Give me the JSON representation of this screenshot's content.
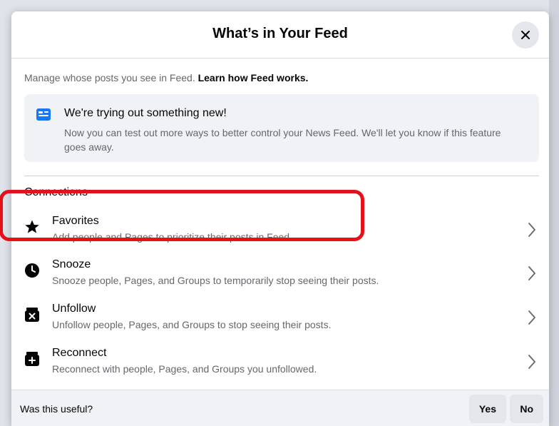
{
  "dialog": {
    "title": "What’s in Your Feed",
    "close_icon": "close-icon"
  },
  "intro": {
    "text": "Manage whose posts you see in Feed. ",
    "link": "Learn how Feed works."
  },
  "notice": {
    "icon": "card-icon",
    "title": "We're trying out something new!",
    "text": "Now you can test out more ways to better control your News Feed. We'll let you know if this feature goes away."
  },
  "connections": {
    "heading": "Connections",
    "items": [
      {
        "icon": "star-icon",
        "title": "Favorites",
        "subtitle": "Add people and Pages to prioritize their posts in Feed."
      },
      {
        "icon": "clock-icon",
        "title": "Snooze",
        "subtitle": "Snooze people, Pages, and Groups to temporarily stop seeing their posts."
      },
      {
        "icon": "unfollow-icon",
        "title": "Unfollow",
        "subtitle": "Unfollow people, Pages, and Groups to stop seeing their posts."
      },
      {
        "icon": "reconnect-icon",
        "title": "Reconnect",
        "subtitle": "Reconnect with people, Pages, and Groups you unfollowed."
      }
    ]
  },
  "feedback": {
    "question": "Was this useful?",
    "yes": "Yes",
    "no": "No"
  },
  "colors": {
    "highlight": "#e3111b",
    "accent": "#1877f2",
    "secondary_text": "#65676b"
  }
}
